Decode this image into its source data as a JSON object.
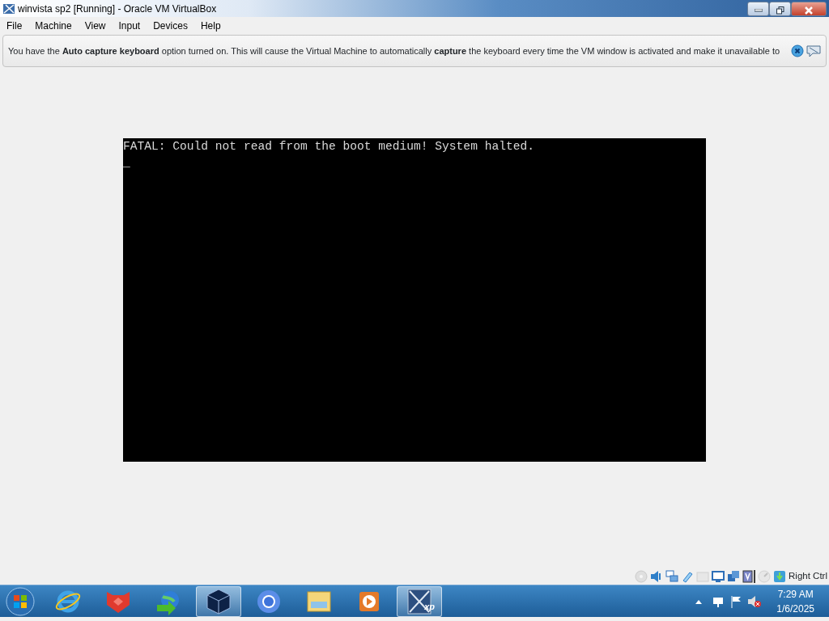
{
  "window": {
    "title": "winvista sp2 [Running] - Oracle VM VirtualBox"
  },
  "menu": [
    "File",
    "Machine",
    "View",
    "Input",
    "Devices",
    "Help"
  ],
  "notice": {
    "message": "You have the **Auto capture keyboard** option turned on. This will cause the Virtual Machine to automatically **capture** the keyboard every time the VM window is activated and make it unavailable to"
  },
  "vm_screen": {
    "lines": [
      "FATAL: Could not read from the boot medium! System halted.",
      "_"
    ]
  },
  "status_bar": {
    "indicators": [
      {
        "kind": "disc",
        "disabled": true
      },
      {
        "kind": "audio",
        "disabled": false
      },
      {
        "kind": "network",
        "disabled": false
      },
      {
        "kind": "usb",
        "disabled": false
      },
      {
        "kind": "folder",
        "disabled": true
      },
      {
        "kind": "display",
        "disabled": false
      },
      {
        "kind": "recording",
        "disabled": false
      },
      {
        "kind": "vtx",
        "disabled": false
      },
      {
        "kind": "mouse",
        "disabled": true
      },
      {
        "kind": "keyboard",
        "disabled": false
      }
    ],
    "host_key": "Right Ctrl"
  },
  "taskbar": {
    "apps": [
      {
        "kind": "ie",
        "selected": false
      },
      {
        "kind": "foxit",
        "selected": false
      },
      {
        "kind": "download",
        "selected": false
      },
      {
        "kind": "virtualbox",
        "selected": true
      },
      {
        "kind": "chrome",
        "selected": false
      },
      {
        "kind": "explorer",
        "selected": false
      },
      {
        "kind": "media",
        "selected": false
      },
      {
        "kind": "xp",
        "selected": true,
        "badge": "xp"
      }
    ],
    "time": "7:29 AM",
    "date": "1/6/2025"
  }
}
